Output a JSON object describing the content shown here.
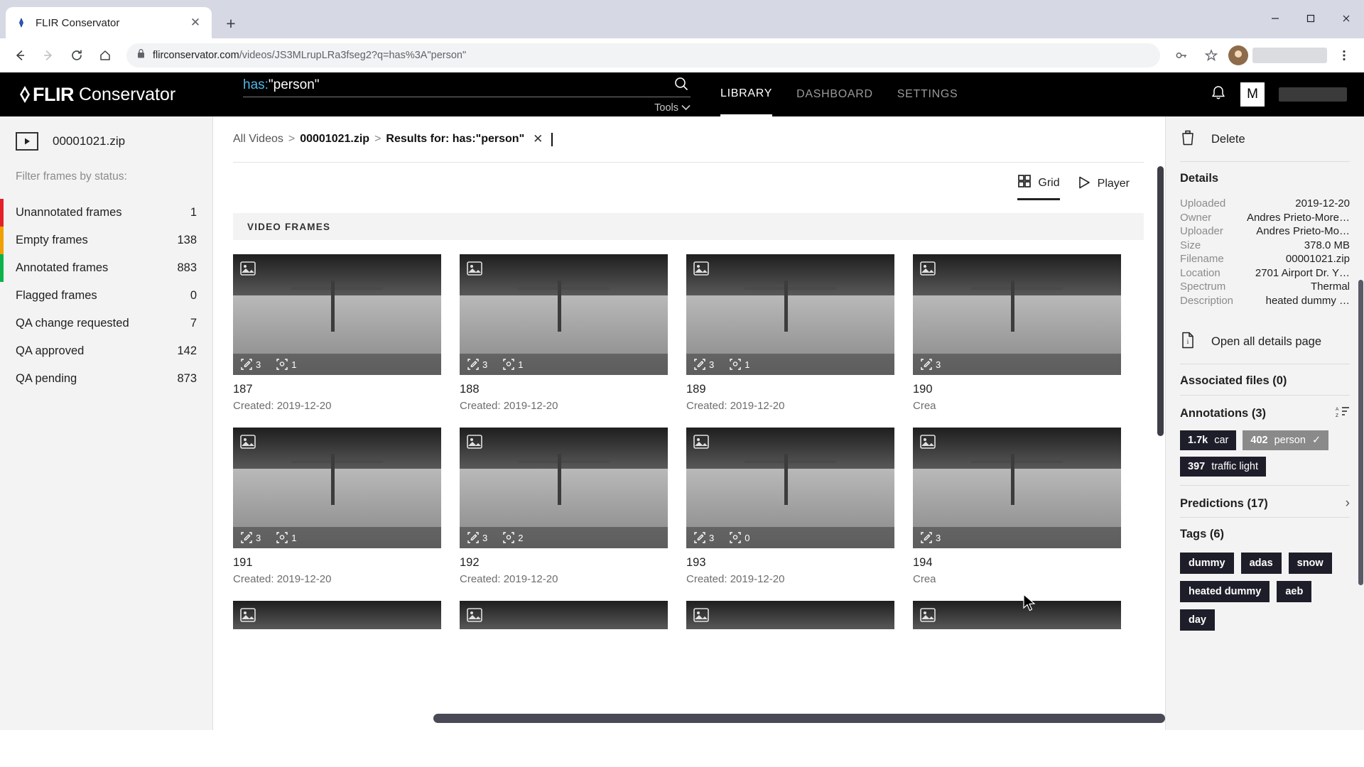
{
  "browser": {
    "tab": {
      "title": "FLIR Conservator",
      "favicon": "flir-diamond-icon",
      "close": "✕"
    },
    "newtab_label": "+",
    "window_controls": {
      "minimize": "─",
      "maximize": "☐",
      "close": "✕"
    },
    "nav": {
      "back": "←",
      "forward": "→",
      "reload": "↻",
      "home": "⌂"
    },
    "omnibox": {
      "lock": "lock-icon",
      "host": "flirconservator.com",
      "path": "/videos/JS3MLrupLRa3fseg2?q=has%3A\"person\"",
      "key_icon": "password-key-icon",
      "star_icon": "bookmark-star-icon",
      "menu_icon": "kebab-menu-icon"
    }
  },
  "header": {
    "brand_flir": "FLIR",
    "brand_product": "Conservator",
    "search": {
      "operator": "has:",
      "value": "\"person\"",
      "tools_label": "Tools",
      "search_icon": "search-icon"
    },
    "nav_links": [
      {
        "label": "LIBRARY",
        "active": true
      },
      {
        "label": "DASHBOARD",
        "active": false
      },
      {
        "label": "SETTINGS",
        "active": false
      }
    ],
    "bell_icon": "notification-bell-icon",
    "user_initial": "M"
  },
  "sidebar": {
    "zip_name": "00001021.zip",
    "zip_icon": "video-play-icon",
    "filter_label": "Filter frames by status:",
    "items": [
      {
        "label": "Unannotated frames",
        "count": "1",
        "color": "#e4212b"
      },
      {
        "label": "Empty frames",
        "count": "138",
        "color": "#f0a000"
      },
      {
        "label": "Annotated frames",
        "count": "883",
        "color": "#0bb34a"
      },
      {
        "label": "Flagged frames",
        "count": "0",
        "color": ""
      },
      {
        "label": "QA change requested",
        "count": "7",
        "color": ""
      },
      {
        "label": "QA approved",
        "count": "142",
        "color": ""
      },
      {
        "label": "QA pending",
        "count": "873",
        "color": ""
      }
    ]
  },
  "breadcrumb": {
    "all_videos": "All Videos",
    "sep": ">",
    "zip": "00001021.zip",
    "results": "Results for: has:\"person\"",
    "clear": "✕"
  },
  "viewtoggle": {
    "grid": {
      "label": "Grid",
      "icon": "grid-view-icon",
      "active": true
    },
    "player": {
      "label": "Player",
      "icon": "play-triangle-icon",
      "active": false
    }
  },
  "frames_section_title": "VIDEO FRAMES",
  "frames": [
    {
      "id": "187",
      "created": "Created: 2019-12-20",
      "annotations": "3",
      "predictions": "1"
    },
    {
      "id": "188",
      "created": "Created: 2019-12-20",
      "annotations": "3",
      "predictions": "1"
    },
    {
      "id": "189",
      "created": "Created: 2019-12-20",
      "annotations": "3",
      "predictions": "1"
    },
    {
      "id": "190",
      "created": "Crea",
      "annotations": "3",
      "predictions": ""
    },
    {
      "id": "191",
      "created": "Created: 2019-12-20",
      "annotations": "3",
      "predictions": "1"
    },
    {
      "id": "192",
      "created": "Created: 2019-12-20",
      "annotations": "3",
      "predictions": "2"
    },
    {
      "id": "193",
      "created": "Created: 2019-12-20",
      "annotations": "3",
      "predictions": "0"
    },
    {
      "id": "194",
      "created": "Crea",
      "annotations": "3",
      "predictions": ""
    }
  ],
  "rightpanel": {
    "delete": {
      "label": "Delete",
      "icon": "trash-icon"
    },
    "details_title": "Details",
    "details": [
      {
        "key": "Uploaded",
        "value": "2019-12-20"
      },
      {
        "key": "Owner",
        "value": "Andres Prieto-More…"
      },
      {
        "key": "Uploader",
        "value": "Andres Prieto-Mo…"
      },
      {
        "key": "Size",
        "value": "378.0 MB"
      },
      {
        "key": "Filename",
        "value": "00001021.zip"
      },
      {
        "key": "Location",
        "value": "2701 Airport Dr. Y…"
      },
      {
        "key": "Spectrum",
        "value": "Thermal"
      },
      {
        "key": "Description",
        "value": "heated dummy …"
      }
    ],
    "open_details": {
      "label": "Open all details page",
      "icon": "document-info-icon"
    },
    "associated_files_title": "Associated files (0)",
    "annotations_title": "Annotations (3)",
    "sort_icon": "sort-alpha-icon",
    "annotation_chips": [
      {
        "count": "1.7k",
        "label": "car",
        "selected": false,
        "check": ""
      },
      {
        "count": "402",
        "label": "person",
        "selected": true,
        "check": "✓"
      },
      {
        "count": "397",
        "label": "traffic light",
        "selected": false,
        "check": ""
      }
    ],
    "predictions_title": "Predictions (17)",
    "predictions_chevron": "›",
    "tags_title": "Tags (6)",
    "tags": [
      "dummy",
      "adas",
      "snow",
      "heated dummy",
      "aeb",
      "day"
    ]
  },
  "colors": {
    "header_bg": "#000000",
    "accent_blue": "#4db8e8",
    "chip_dark": "#1e1e2a",
    "chip_selected": "#8a8a8a"
  }
}
